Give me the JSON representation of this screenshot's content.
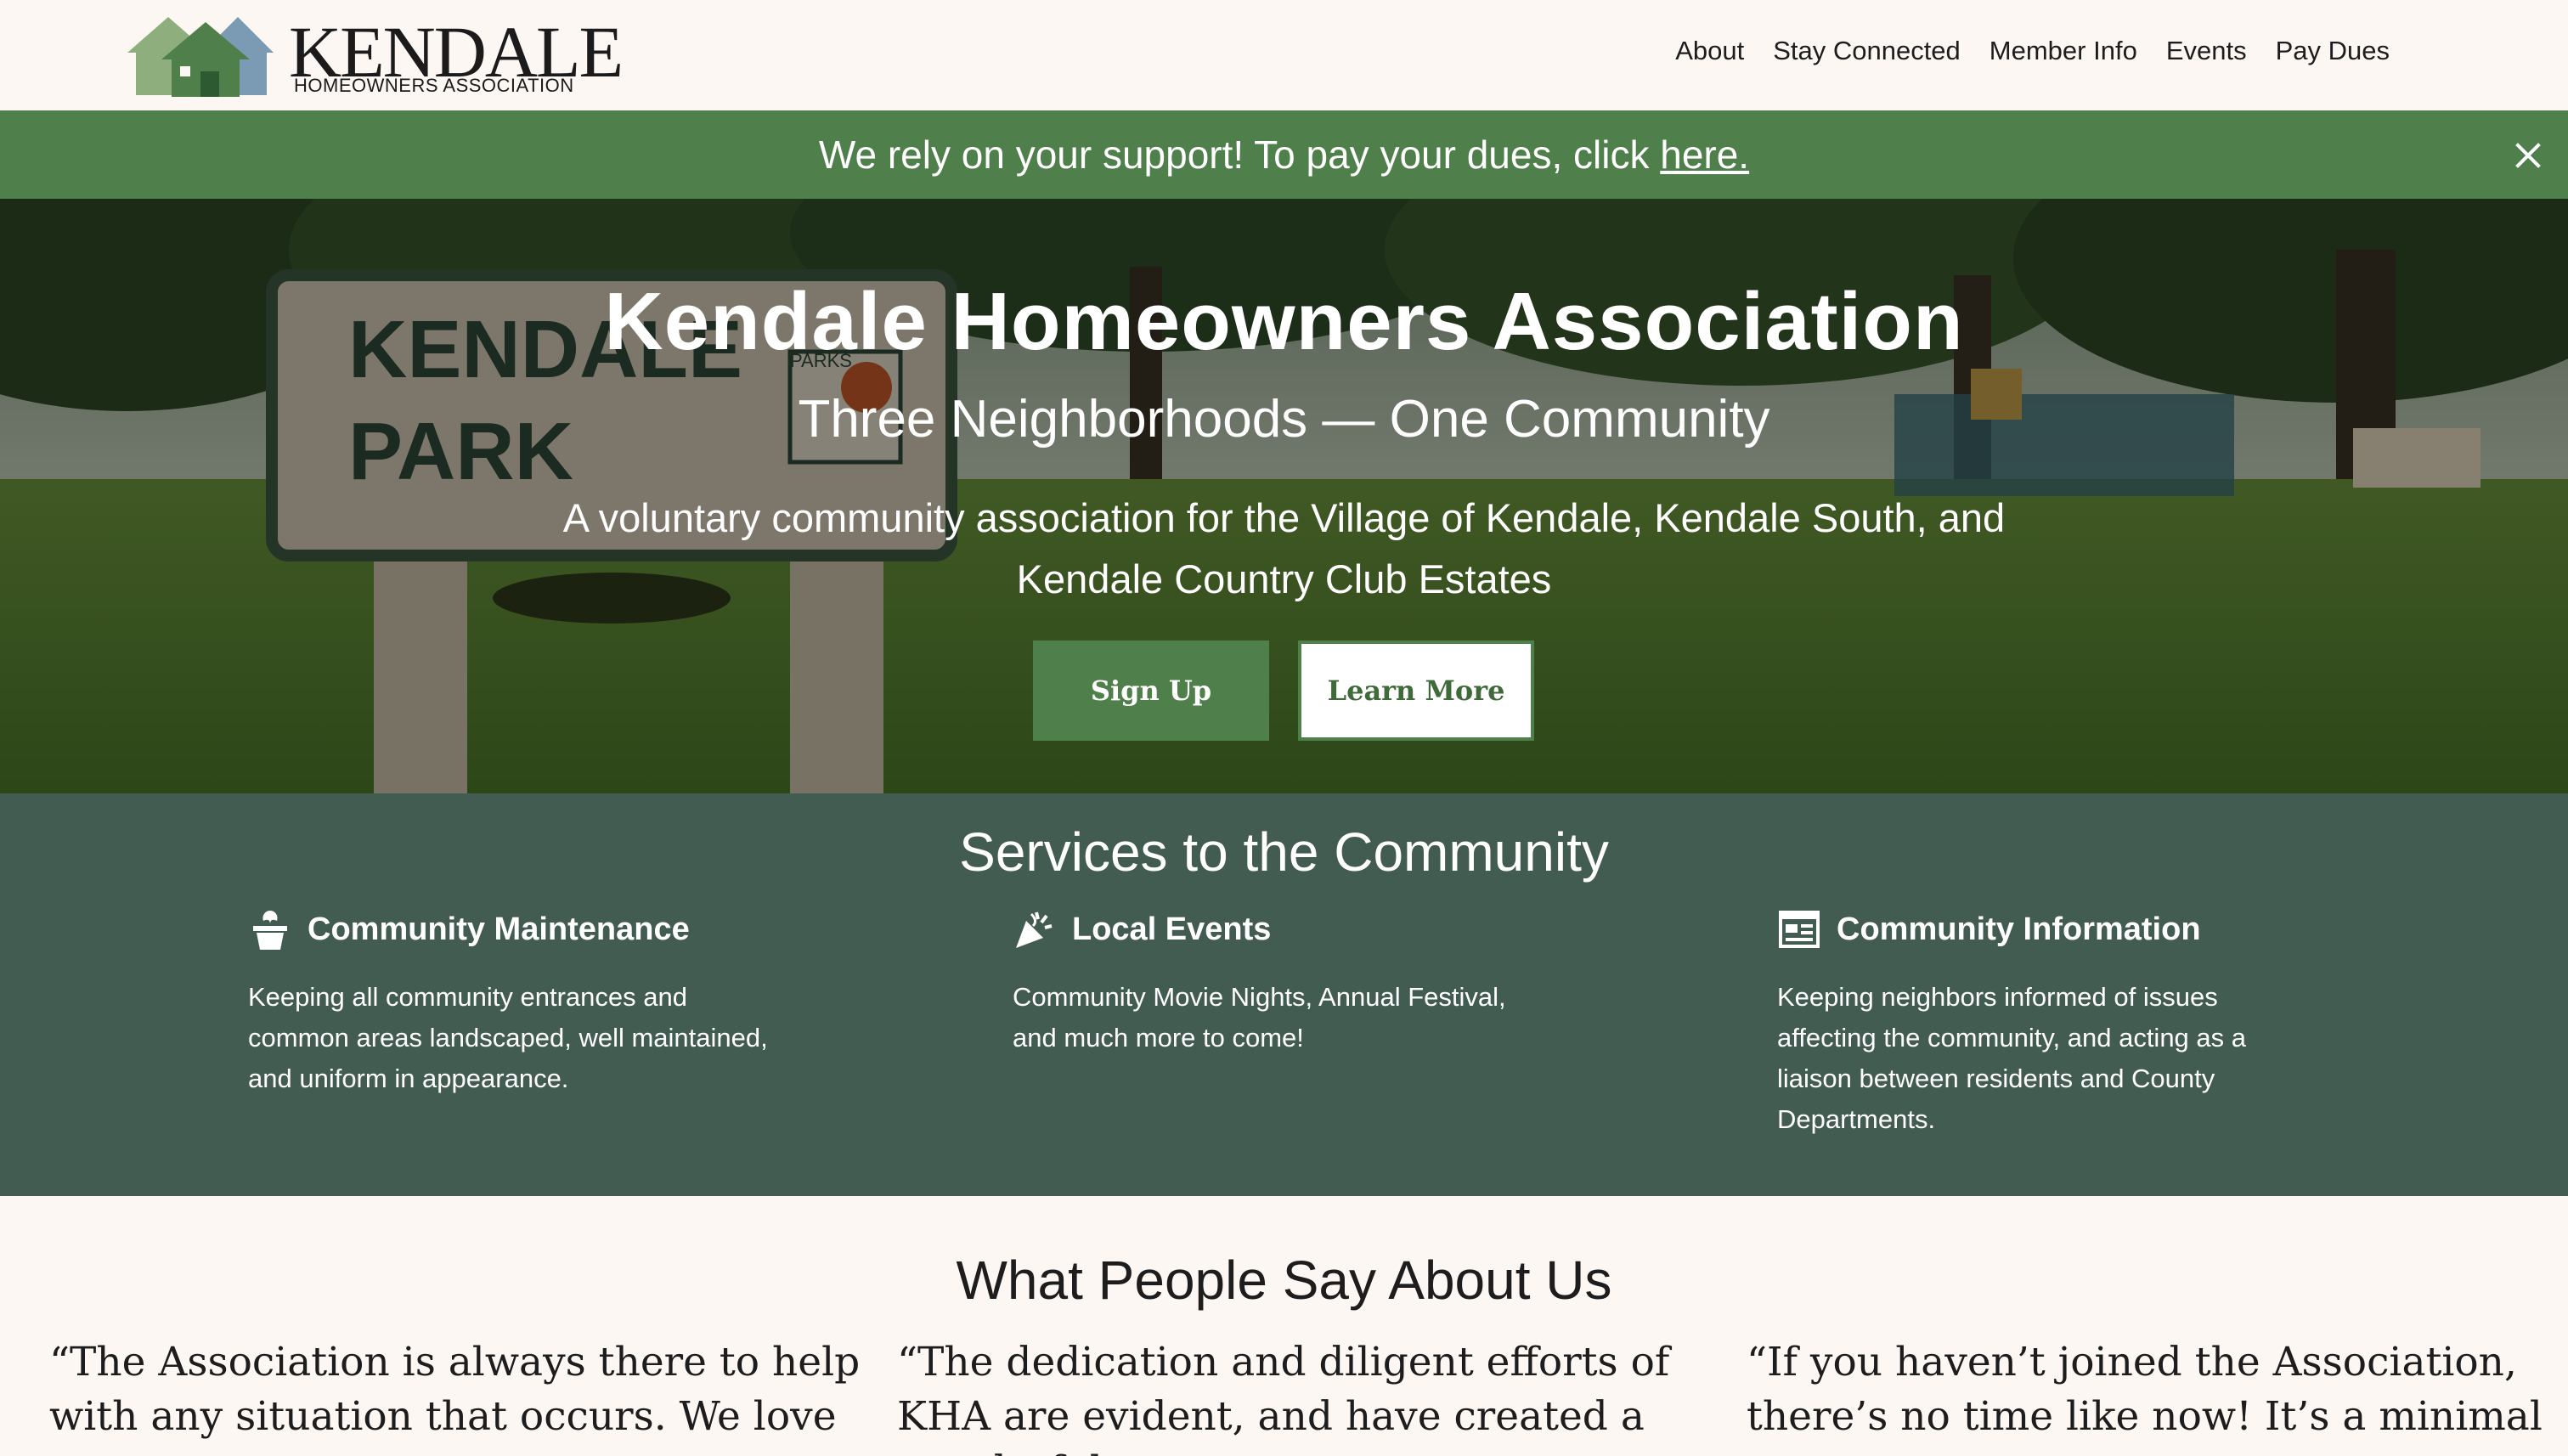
{
  "brand": {
    "name": "KENDALE",
    "subtitle": "HOMEOWNERS ASSOCIATION"
  },
  "nav": [
    {
      "label": "About"
    },
    {
      "label": "Stay Connected"
    },
    {
      "label": "Member Info"
    },
    {
      "label": "Events"
    },
    {
      "label": "Pay Dues"
    }
  ],
  "banner": {
    "text": "We rely on your support! To pay your dues, click ",
    "link": "here."
  },
  "hero": {
    "title": "Kendale Homeowners Association",
    "subtitle": "Three Neighborhoods — One Community",
    "description": "A voluntary community association for the Village of Kendale, Kendale South, and Kendale Country Club Estates",
    "signup_label": "Sign Up",
    "learn_label": "Learn More",
    "sign_text_line1": "KENDALE",
    "sign_text_line2": "PARK",
    "sign_small": "PARKS"
  },
  "services": {
    "title": "Services to the Community",
    "items": [
      {
        "icon": "potted-plant-icon",
        "title": "Community Maintenance",
        "description": "Keeping all community entrances and common areas landscaped, well maintained, and uniform in appearance."
      },
      {
        "icon": "party-popper-icon",
        "title": "Local Events",
        "description": "Community Movie Nights, Annual Festival, and much more to come!"
      },
      {
        "icon": "newspaper-icon",
        "title": "Community Information",
        "description": "Keeping neighbors informed of issues affecting the community, and acting as a liaison between residents and County Departments."
      }
    ]
  },
  "testimonials": {
    "title": "What People Say About Us",
    "quotes": [
      {
        "text": "“The Association is always there to help with any situation that occurs. We love"
      },
      {
        "text": "“The dedication and diligent efforts of KHA are evident, and have created a wonderful"
      },
      {
        "text": "“If you haven’t joined the Association, there’s no time like now! It’s a minimal"
      }
    ]
  },
  "colors": {
    "green": "#4f7f4a",
    "dark_green": "#425c52",
    "background": "#fcf7f3"
  }
}
